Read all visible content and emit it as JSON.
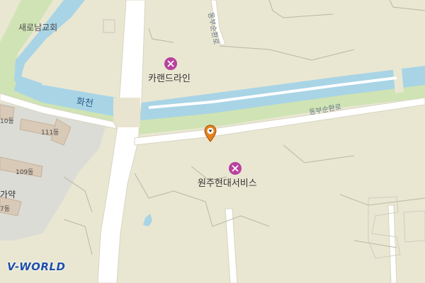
{
  "map": {
    "labels": {
      "church": "새로남교회",
      "river": "화천",
      "poi_caran": "카랜드라인",
      "poi_wonju": "원주현대서비스",
      "road_east": "동부순환로",
      "road_north": "동부순환로",
      "bldg_111": "111동",
      "bldg_109": "109동",
      "bldg_110": "10동",
      "bldg_7": "7동",
      "area_gaya": "가약"
    },
    "logo": "V-WORLD",
    "colors": {
      "land": "#e9e7d2",
      "water": "#a8d4e6",
      "riverbank": "#cfe3b4",
      "road": "#ffffff",
      "urban": "#dcdcd6",
      "building": "#d9c9b7",
      "poi": "#b8429e",
      "marker": "#e8801a"
    },
    "icons": {
      "poi": "wrench-screwdriver-icon",
      "marker": "location-pin-icon"
    }
  }
}
